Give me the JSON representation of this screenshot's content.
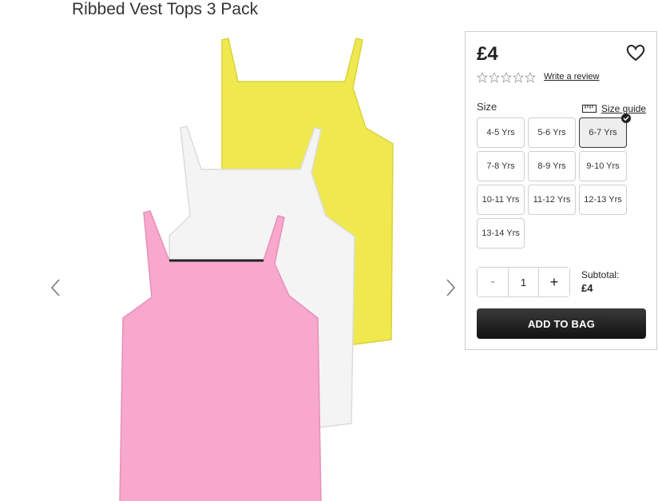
{
  "product": {
    "title": "Ribbed Vest Tops 3 Pack",
    "price": "£4",
    "colors": {
      "yellow": "#efe94f",
      "white": "#f4f4f4",
      "pink": "#f7a8cc"
    }
  },
  "gallery": {
    "prev_icon": "chevron-left-icon",
    "next_icon": "chevron-right-icon"
  },
  "reviews": {
    "stars_filled": 0,
    "stars_total": 5,
    "write_review_label": "Write a review"
  },
  "size": {
    "label": "Size",
    "guide_label": "Size guide",
    "selected": "6-7 Yrs",
    "options": [
      "4-5 Yrs",
      "5-6 Yrs",
      "6-7 Yrs",
      "7-8 Yrs",
      "8-9 Yrs",
      "9-10 Yrs",
      "10-11 Yrs",
      "11-12 Yrs",
      "12-13 Yrs",
      "13-14 Yrs"
    ]
  },
  "quantity": {
    "minus_label": "-",
    "value": "1",
    "plus_label": "+"
  },
  "subtotal": {
    "label": "Subtotal:",
    "value": "£4"
  },
  "cta": {
    "add_to_bag_label": "ADD TO BAG"
  }
}
